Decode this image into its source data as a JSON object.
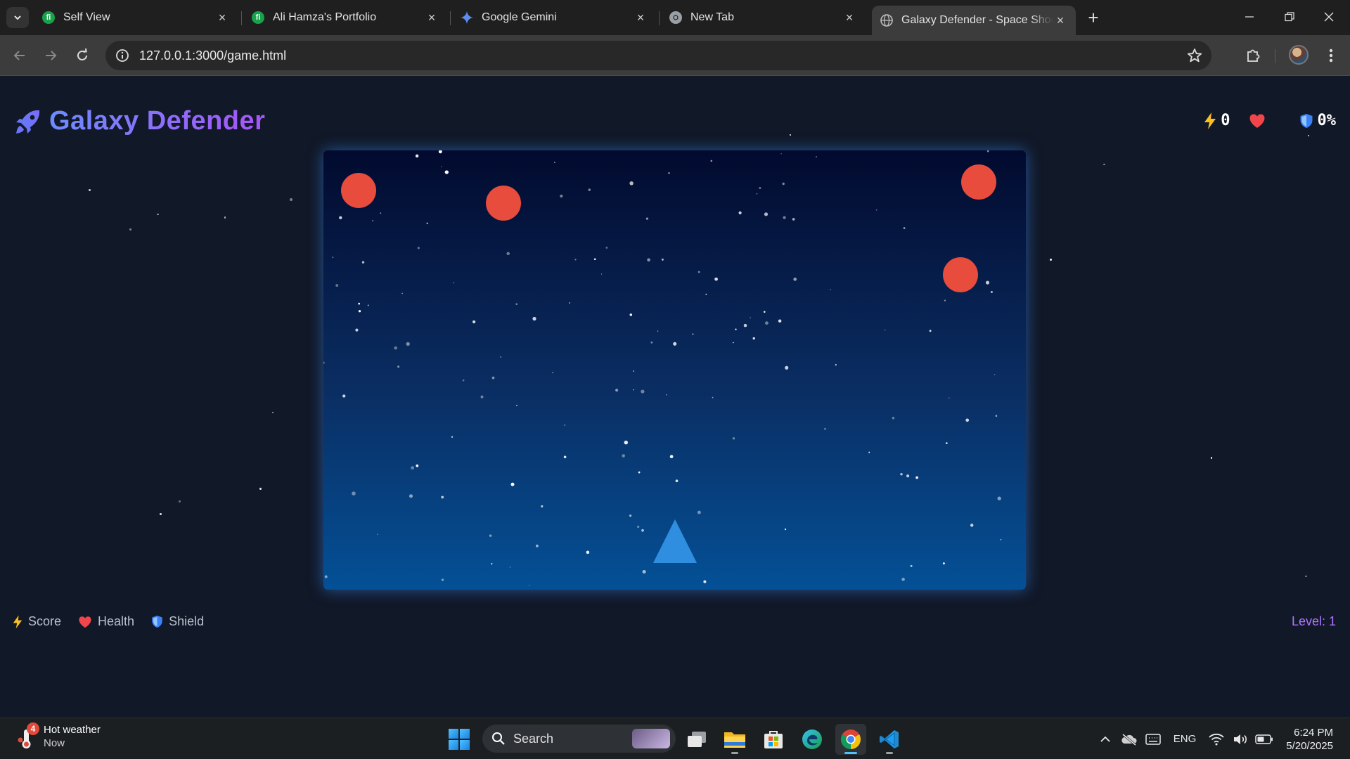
{
  "browser": {
    "tabs": [
      {
        "title": "Self View",
        "favicon": "fiverr-icon"
      },
      {
        "title": "Ali Hamza's Portfolio",
        "favicon": "fiverr-icon"
      },
      {
        "title": "Google Gemini",
        "favicon": "gemini-icon"
      },
      {
        "title": "New Tab",
        "favicon": "chrome-icon"
      },
      {
        "title": "Galaxy Defender - Space Shooter",
        "favicon": "globe-icon",
        "active": true
      }
    ],
    "url": "127.0.0.1:3000/game.html"
  },
  "game": {
    "title": "Galaxy Defender",
    "hud": {
      "score": "0",
      "shield": "0%"
    },
    "legend": {
      "score_label": "Score",
      "health_label": "Health",
      "shield_label": "Shield"
    },
    "level_text": "Level: 1",
    "colors": {
      "enemy": "#e74c3c",
      "player": "#2f8ee0",
      "title_start": "#6d8bff",
      "title_end": "#a855f7",
      "level": "#b174ff"
    }
  },
  "taskbar": {
    "weather": {
      "title": "Hot weather",
      "subtitle": "Now",
      "badge": "4"
    },
    "search_label": "Search",
    "tray_lang": "ENG",
    "time": "6:24 PM",
    "date": "5/20/2025"
  }
}
